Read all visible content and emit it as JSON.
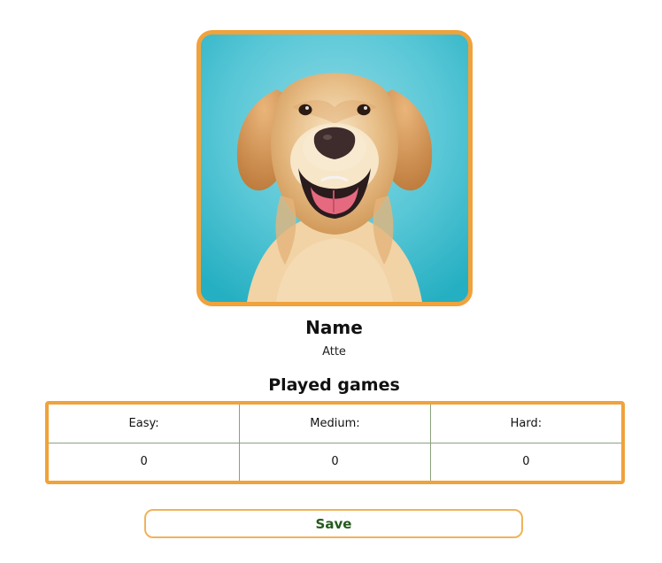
{
  "profile": {
    "avatar_icon": "golden-retriever-photo",
    "name_label": "Name",
    "name_value": "Atte"
  },
  "games": {
    "heading": "Played games",
    "headers": [
      "Easy:",
      "Medium:",
      "Hard:"
    ],
    "values": [
      "0",
      "0",
      "0"
    ]
  },
  "actions": {
    "save_label": "Save"
  },
  "colors": {
    "accent": "#f0a23b",
    "table_border": "#8aa27e",
    "save_text": "#245a1c",
    "avatar_background": "#4cc4d2"
  }
}
